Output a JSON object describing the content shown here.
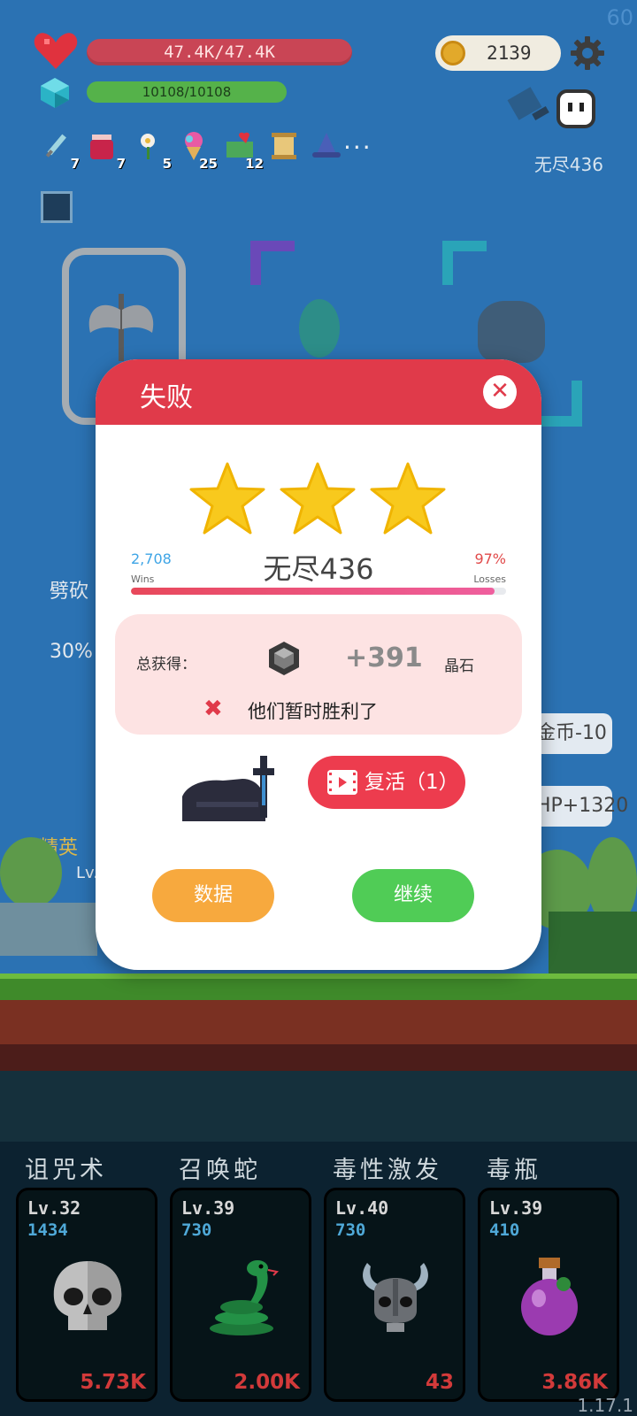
{
  "hud": {
    "fps": "60",
    "hp_text": "47.4K/47.4K",
    "mp_text": "10108/10108",
    "coins": "2139",
    "stage_label": "无尽436",
    "version": "1.17.1"
  },
  "items": [
    {
      "icon": "syringe-icon",
      "count": "7"
    },
    {
      "icon": "jam-jar-icon",
      "count": "7"
    },
    {
      "icon": "flower-icon",
      "count": "5"
    },
    {
      "icon": "ice-cream-icon",
      "count": "25"
    },
    {
      "icon": "cash-heart-icon",
      "count": "12"
    },
    {
      "icon": "scroll-icon",
      "count": ""
    },
    {
      "icon": "wizard-hat-icon",
      "count": ""
    }
  ],
  "more_label": "···",
  "side": {
    "left_text_1": "劈砍",
    "left_text_2": "30%",
    "pill_1": "金币-10",
    "pill_2": "HP+1320",
    "elite_label": "精英",
    "elite_level": "Lv."
  },
  "skills": [
    {
      "name": "诅咒术",
      "level": "Lv.32",
      "cost": "1434",
      "value": "5.73K",
      "icon": "skull-icon"
    },
    {
      "name": "召唤蛇",
      "level": "Lv.39",
      "cost": "730",
      "value": "2.00K",
      "icon": "snake-icon"
    },
    {
      "name": "毒性激发",
      "level": "Lv.40",
      "cost": "730",
      "value": "43",
      "icon": "viking-helmet-icon"
    },
    {
      "name": "毒瓶",
      "level": "Lv.39",
      "cost": "410",
      "value": "3.86K",
      "icon": "poison-flask-icon"
    }
  ],
  "modal": {
    "title": "失败",
    "close_label": "✕",
    "stars": 3,
    "wins_value": "2,708",
    "wins_label": "Wins",
    "losses_value": "97%",
    "losses_label": "Losses",
    "level_name": "无尽436",
    "progress_fraction": 0.97,
    "total_label": "总获得：",
    "reward_amount": "+391",
    "reward_unit": "晶石",
    "defeat_message": "他们暂时胜利了",
    "revive_label": "复活（1）",
    "data_button": "数据",
    "continue_button": "继续"
  },
  "colors": {
    "modal_header": "#e03a4a",
    "hp_bar": "#c94555",
    "mp_bar": "#55b24a",
    "star": "#f8c91d",
    "data_button": "#f7a93e",
    "continue_button": "#50cc56"
  }
}
